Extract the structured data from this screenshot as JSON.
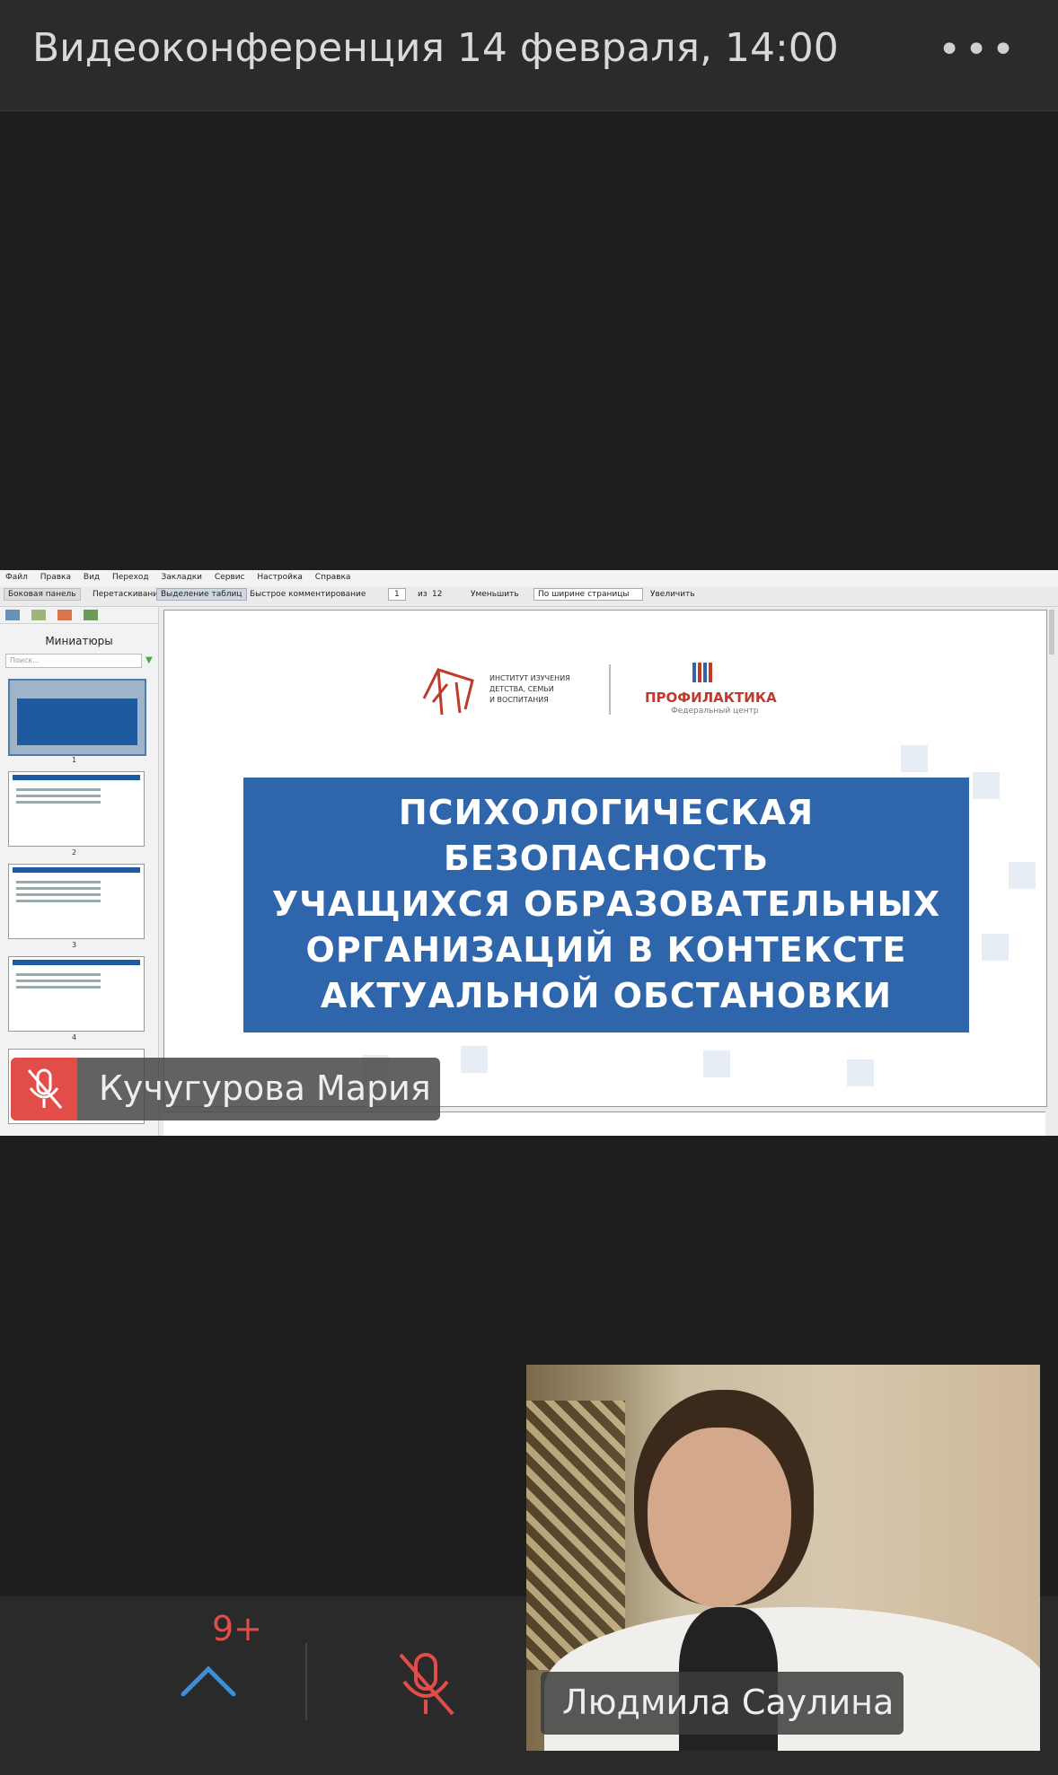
{
  "header": {
    "title": "Видеоконференция 14 февраля, 14:00",
    "more_icon": "more-dots-icon",
    "more_glyph": "•••"
  },
  "viewer": {
    "menu": [
      "Файл",
      "Правка",
      "Вид",
      "Переход",
      "Закладки",
      "Сервис",
      "Настройка",
      "Справка"
    ],
    "toolbar": {
      "sidebar_btn": "Боковая панель",
      "drag": "Перетаскивание",
      "select_table": "Выделение таблиц",
      "quick_comment": "Быстрое комментирование",
      "page_current": "1",
      "page_of": "из",
      "page_total": "12",
      "zoom_out": "Уменьшить",
      "zoom_mode": "По ширине страницы",
      "zoom_in": "Увеличить"
    },
    "sidebar": {
      "title": "Миниатюры",
      "search_placeholder": "Поиск...",
      "thumb_numbers": [
        "1",
        "2",
        "3",
        "4"
      ]
    },
    "slide": {
      "logo_left_text": "ИНСТИТУТ ИЗУЧЕНИЯ\nДЕТСТВА, СЕМЬИ\nИ ВОСПИТАНИЯ",
      "logo_right": "ПРОФИЛАКТИКА",
      "logo_right_sub": "Федеральный центр",
      "title_lines": [
        "ПСИХОЛОГИЧЕСКАЯ",
        "БЕЗОПАСНОСТЬ",
        "УЧАЩИХСЯ ОБРАЗОВАТЕЛЬНЫХ",
        "ОРГАНИЗАЦИЙ В КОНТЕКСТЕ",
        "АКТУАЛЬНОЙ ОБСТАНОВКИ"
      ]
    }
  },
  "presenter": {
    "name": "Кучугурова Мария",
    "muted": true
  },
  "controls": {
    "participants_badge": "9+",
    "expand_icon": "chevron-up-icon",
    "mic_icon": "mic-off-icon"
  },
  "participant": {
    "name": "Людмила Саулина"
  },
  "colors": {
    "accent_red": "#e24d4a",
    "slide_blue": "#2f65ab"
  }
}
